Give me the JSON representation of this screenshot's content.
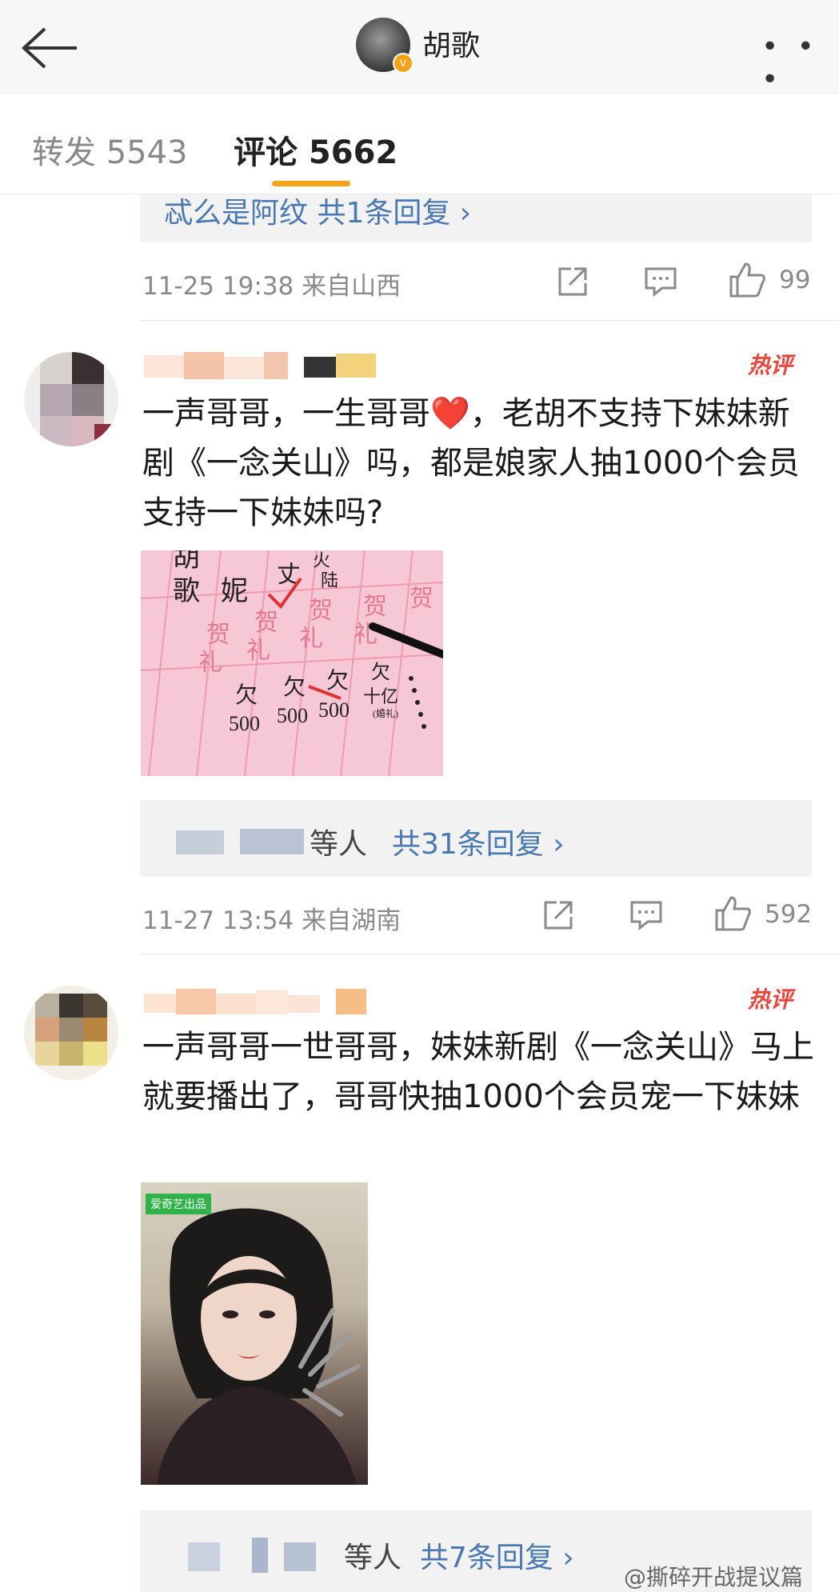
{
  "header": {
    "title": "胡歌",
    "more_label": "• • •"
  },
  "tabs": {
    "repost": "转发 5543",
    "comments": "评论 5662"
  },
  "comment0": {
    "reply_preview": "忒么是阿纹  共1条回复 ›",
    "time": "11-25 19:38 来自山西",
    "likes": "99"
  },
  "comment1": {
    "hot_badge": "热评",
    "text": "一声哥哥，一生哥哥❤️，老胡不支持下妹妹新剧《一念关山》吗，都是娘家人抽1000个会员支持一下妹妹吗?",
    "image": {
      "names": [
        "胡",
        "歌",
        "妮",
        "丈",
        "火",
        "陆"
      ],
      "gift_labels": [
        "贺",
        "礼",
        "贺",
        "礼",
        "贺",
        "礼",
        "贺",
        "礼",
        "贺"
      ],
      "owe_items": [
        "欠",
        "500",
        "欠",
        "500",
        "欠",
        "500",
        "欠",
        "十亿",
        "(婚礼)"
      ]
    },
    "reply_suffix": "等人",
    "reply_count": "共31条回复 ›",
    "time": "11-27 13:54 来自湖南",
    "likes": "592"
  },
  "comment2": {
    "hot_badge": "热评",
    "text": "一声哥哥一世哥哥，妹妹新剧《一念关山》马上就要播出了，哥哥快抽1000个会员宠一下妹妹",
    "image_badge": "爱奇艺出品",
    "reply_suffix": "等人",
    "reply_count": "共7条回复 ›"
  },
  "watermark": "@撕碎开战提议篇",
  "colors": {
    "accent": "#f7a21b",
    "link": "#4a78b0",
    "hot": "#e8453c",
    "meta": "#8a8a8a"
  }
}
